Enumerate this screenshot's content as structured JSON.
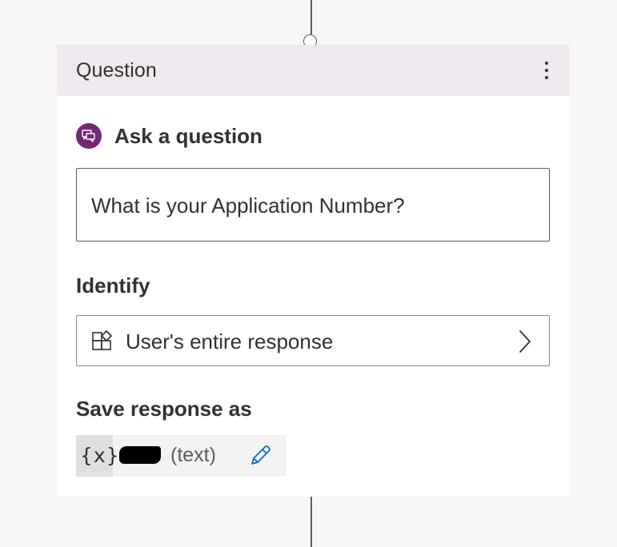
{
  "card": {
    "title": "Question"
  },
  "ask": {
    "label": "Ask a question",
    "question_text": "What is your Application Number?"
  },
  "identify": {
    "label": "Identify",
    "value": "User's entire response"
  },
  "save": {
    "label": "Save response as",
    "variable_icon": "{x}",
    "variable_name": "",
    "variable_type": "(text)"
  },
  "icons": {
    "more": "more-vertical-icon",
    "ask": "chat-bubbles-icon",
    "entity": "entity-shapes-icon",
    "chevron": "chevron-right-icon",
    "variable": "variable-icon",
    "edit": "pencil-icon"
  },
  "colors": {
    "header_bg": "#efe8ef",
    "accent_purple": "#742774",
    "edit_icon": "#0f6cbd",
    "canvas_bg": "#f8f7f6"
  }
}
